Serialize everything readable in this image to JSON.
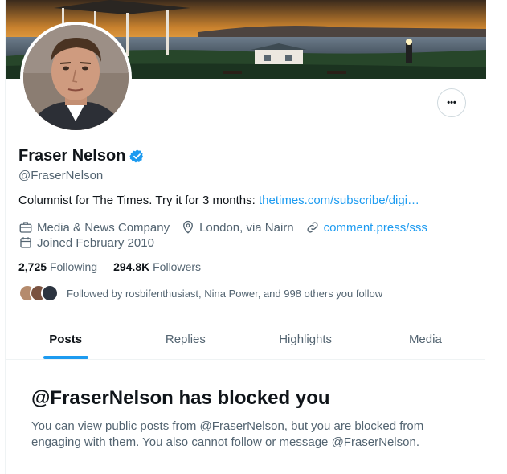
{
  "profile": {
    "name": "Fraser Nelson",
    "handle": "@FraserNelson",
    "bio_text": "Columnist for The Times. Try it for 3 months: ",
    "bio_link": "thetimes.com/subscribe/digi…",
    "category": "Media & News Company",
    "location": "London, via Nairn",
    "website": "comment.press/sss",
    "joined": "Joined February 2010",
    "following_count": "2,725",
    "following_label": "Following",
    "followers_count": "294.8K",
    "followers_label": "Followers",
    "followed_by": "Followed by rosbifenthusiast, Nina Power, and 998 others you follow"
  },
  "actions": {
    "more_label": "•••"
  },
  "tabs": [
    {
      "label": "Posts",
      "active": true
    },
    {
      "label": "Replies",
      "active": false
    },
    {
      "label": "Highlights",
      "active": false
    },
    {
      "label": "Media",
      "active": false
    }
  ],
  "blocked": {
    "title": "@FraserNelson has blocked you",
    "message": "You can view public posts from @FraserNelson, but you are blocked from engaging with them. You also cannot follow or message @FraserNelson."
  },
  "colors": {
    "accent": "#1d9bf0",
    "text_primary": "#0f1419",
    "text_secondary": "#536471"
  },
  "icons": {
    "verified": "verified-badge-icon",
    "category": "briefcase-icon",
    "location": "location-pin-icon",
    "website": "link-icon",
    "joined": "calendar-icon",
    "more": "more-dots-icon"
  }
}
